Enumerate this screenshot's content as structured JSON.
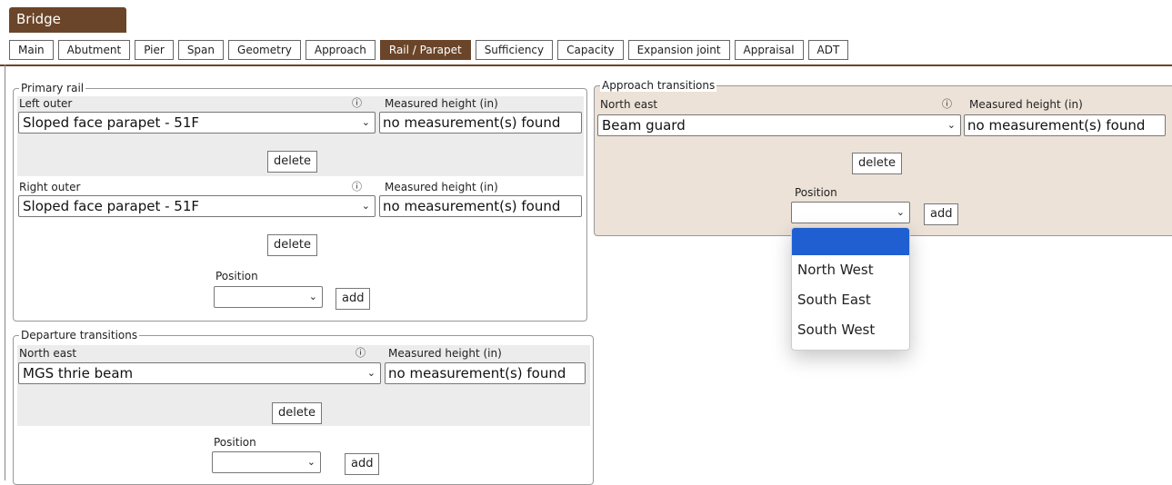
{
  "header": {
    "title": "Bridge"
  },
  "tabs": [
    {
      "label": "Main"
    },
    {
      "label": "Abutment"
    },
    {
      "label": "Pier"
    },
    {
      "label": "Span"
    },
    {
      "label": "Geometry"
    },
    {
      "label": "Approach"
    },
    {
      "label": "Rail / Parapet"
    },
    {
      "label": "Sufficiency"
    },
    {
      "label": "Capacity"
    },
    {
      "label": "Expansion joint"
    },
    {
      "label": "Appraisal"
    },
    {
      "label": "ADT"
    }
  ],
  "active_tab": "Rail / Parapet",
  "common": {
    "info_glyph": "ⓘ",
    "measured_label": "Measured height (in)",
    "delete_label": "delete",
    "add_label": "add",
    "position_label": "Position",
    "chevron": "⌄"
  },
  "primary_rail": {
    "legend": "Primary rail",
    "left": {
      "label": "Left outer",
      "value": "Sloped face parapet - 51F",
      "measured": "no measurement(s) found"
    },
    "right": {
      "label": "Right outer",
      "value": "Sloped face parapet - 51F",
      "measured": "no measurement(s) found"
    },
    "position_value": ""
  },
  "departure": {
    "legend": "Departure transitions",
    "ne": {
      "label": "North east",
      "value": "MGS thrie beam",
      "measured": "no measurement(s) found"
    },
    "position_value": ""
  },
  "approach": {
    "legend": "Approach transitions",
    "ne": {
      "label": "North east",
      "value": "Beam guard",
      "measured": "no measurement(s) found"
    },
    "position_value": "",
    "dropdown_options": [
      "",
      "North West",
      "South East",
      "South West"
    ]
  },
  "colors": {
    "brand": "#6b4529",
    "tan_panel": "#ece2d8",
    "selected_option": "#1f5fd1"
  }
}
